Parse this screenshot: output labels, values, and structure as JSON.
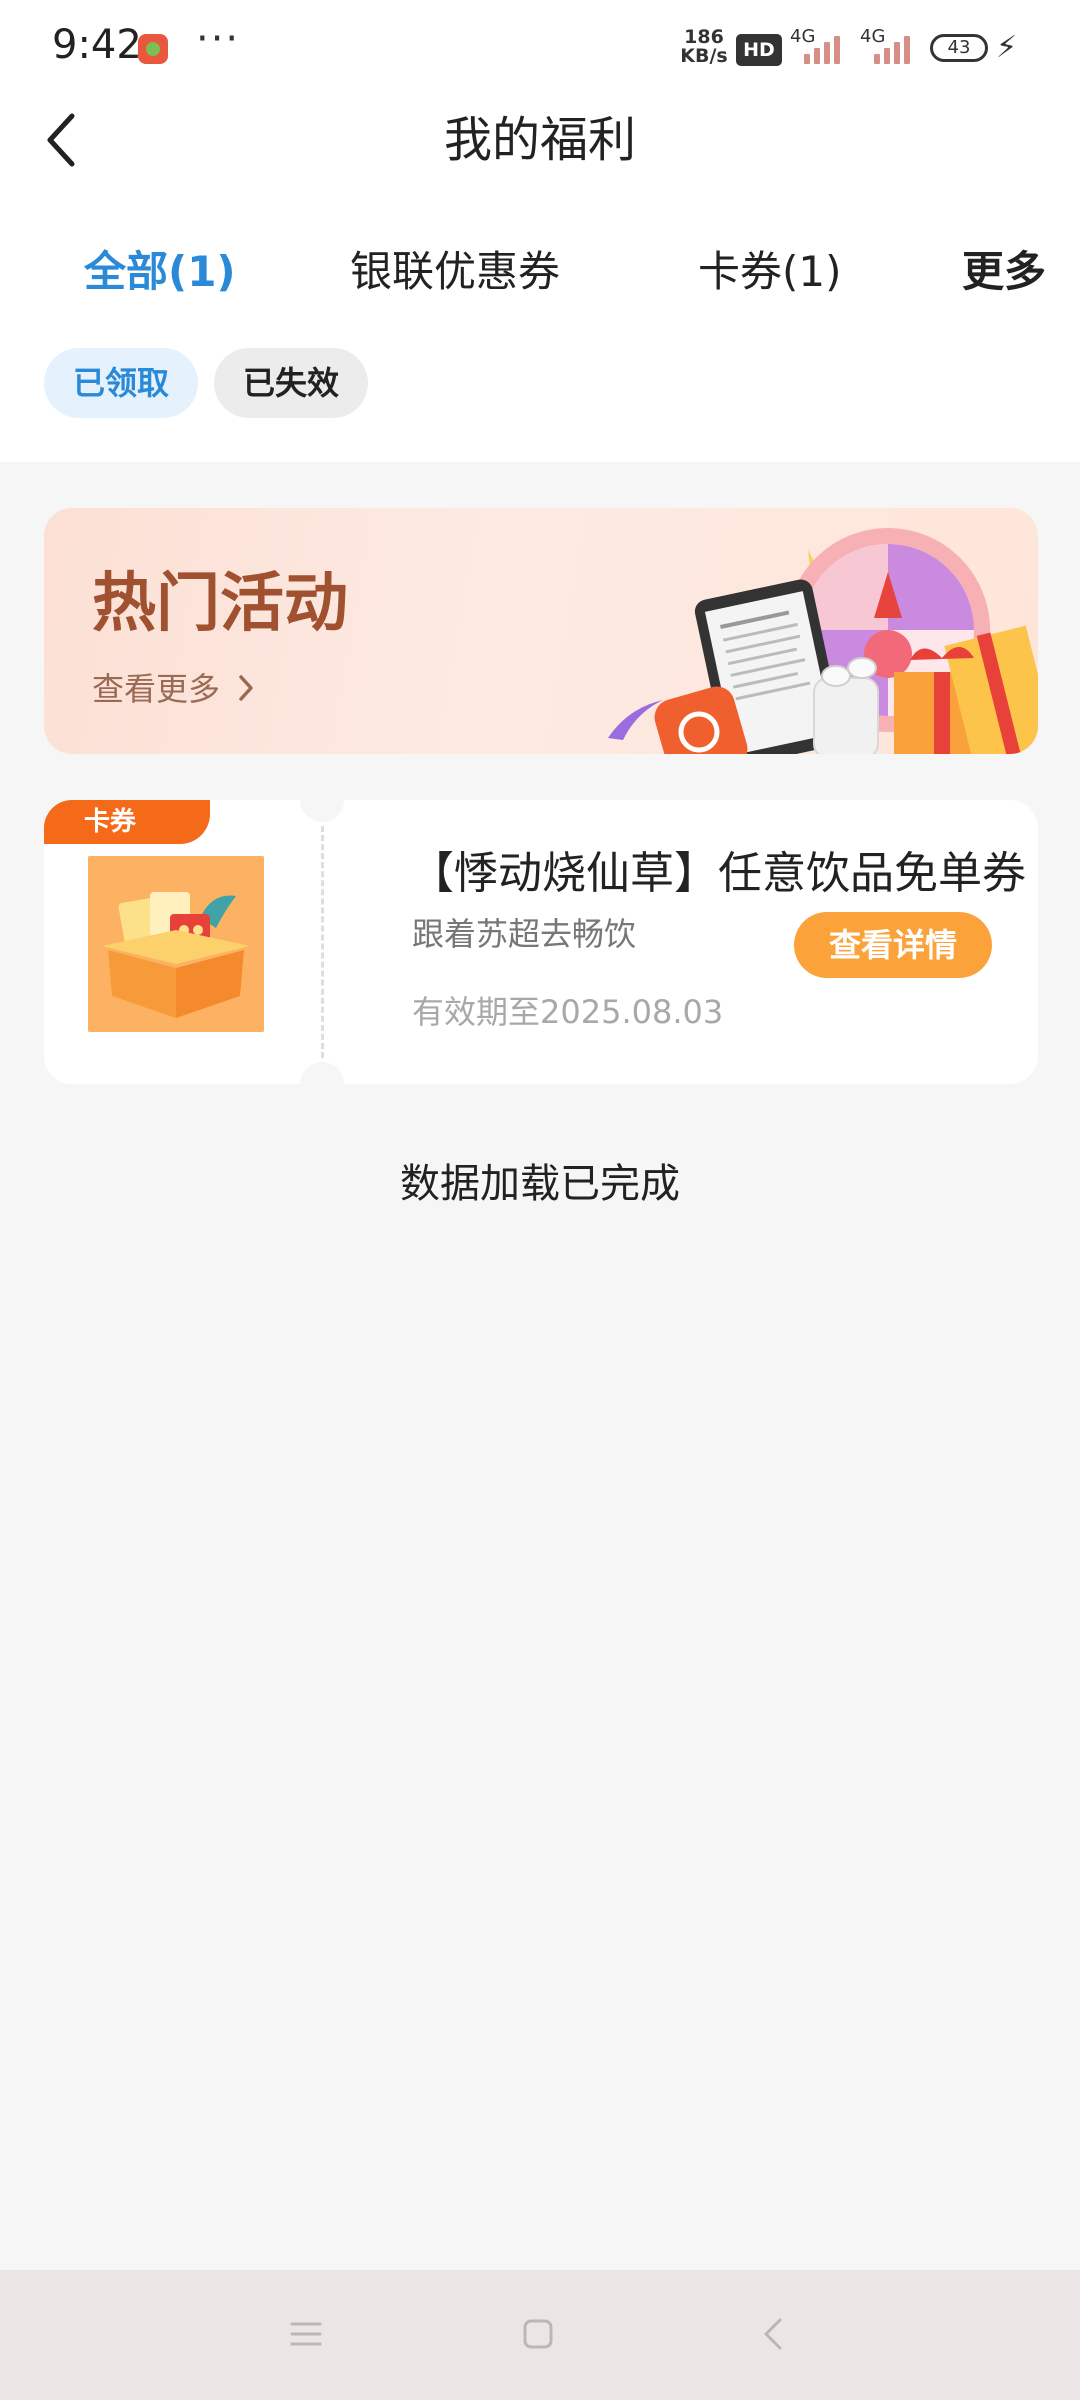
{
  "status_bar": {
    "time": "9:42",
    "more_dots": "···",
    "net_speed_value": "186",
    "net_speed_unit": "KB/s",
    "hd": "HD",
    "signal_1_label": "4G",
    "signal_2_label": "4G",
    "battery": "43"
  },
  "header": {
    "title": "我的福利"
  },
  "tabs": [
    {
      "label": "全部(1)",
      "active": true
    },
    {
      "label": "银联优惠券"
    },
    {
      "label": "卡券(1)"
    },
    {
      "label": "更多"
    }
  ],
  "filters": [
    {
      "label": "已领取",
      "active": true
    },
    {
      "label": "已失效"
    }
  ],
  "banner": {
    "title": "热门活动",
    "more": "查看更多"
  },
  "coupon": {
    "tag": "卡券",
    "title": "【悸动烧仙草】任意饮品免单券",
    "subtitle": "跟着苏超去畅饮",
    "expiry": "有效期至2025.08.03",
    "button": "查看详情"
  },
  "load_status": "数据加载已完成",
  "colors": {
    "accent": "#2a8ad8",
    "tag": "#f56a19",
    "button": "#fba33a",
    "background": "#f6f6f6"
  },
  "icons": [
    "back-arrow-icon",
    "chevron-right-icon",
    "menu-icon",
    "home-icon",
    "back-icon",
    "charging-icon"
  ]
}
